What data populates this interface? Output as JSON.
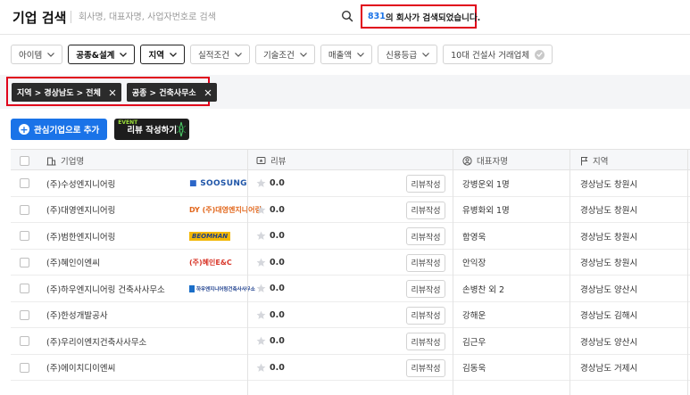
{
  "header": {
    "title": "기업 검색",
    "search_placeholder": "회사명, 대표자명, 사업자번호로 검색",
    "result_count": "831",
    "result_suffix": "의 회사가 검색되었습니다."
  },
  "filters": [
    {
      "label": "아이템",
      "active": false
    },
    {
      "label": "공종&설계",
      "active": true
    },
    {
      "label": "지역",
      "active": true
    },
    {
      "label": "실적조건",
      "active": false
    },
    {
      "label": "기술조건",
      "active": false
    },
    {
      "label": "매출액",
      "active": false
    },
    {
      "label": "신용등급",
      "active": false
    },
    {
      "label": "10대 건설사 거래업체",
      "active": false
    }
  ],
  "chips": [
    {
      "label": "지역 > 경상남도 > 전체"
    },
    {
      "label": "공종 > 건축사무소"
    }
  ],
  "actions": {
    "favorite_label": "관심기업으로 추가",
    "review_label": "리뷰 작성하기",
    "event_tag": "EVENT"
  },
  "table": {
    "headers": {
      "company": "기업명",
      "review": "리뷰",
      "ceo": "대표자명",
      "region": "지역"
    },
    "review_button_label": "리뷰작성",
    "rows": [
      {
        "company": "(주)수성엔지니어링",
        "logo": "SOOSUNG",
        "rating": "0.0",
        "ceo": "강병운외 1명",
        "region": "경상남도 창원시"
      },
      {
        "company": "(주)대영엔지니어링",
        "logo": "DY (주)대영엔지니어링",
        "rating": "0.0",
        "ceo": "유병화외 1명",
        "region": "경상남도 창원시"
      },
      {
        "company": "(주)범한엔지니어링",
        "logo": "BEOMHAN",
        "rating": "0.0",
        "ceo": "함영욱",
        "region": "경상남도 창원시"
      },
      {
        "company": "(주)혜인이엔씨",
        "logo": "(주)혜인E&C",
        "rating": "0.0",
        "ceo": "안익장",
        "region": "경상남도 창원시"
      },
      {
        "company": "(주)하우엔지니어링 건축사사무소",
        "logo": "하우엔지니어링건축사사무소",
        "rating": "0.0",
        "ceo": "손병찬 외 2",
        "region": "경상남도 양산시"
      },
      {
        "company": "(주)한성개발공사",
        "logo": "",
        "rating": "0.0",
        "ceo": "강해운",
        "region": "경상남도 김해시"
      },
      {
        "company": "(주)우리이엔지건축사사무소",
        "logo": "",
        "rating": "0.0",
        "ceo": "김근우",
        "region": "경상남도 양산시"
      },
      {
        "company": "(주)에이치디이엔씨",
        "logo": "",
        "rating": "0.0",
        "ceo": "김동욱",
        "region": "경상남도 거제시"
      }
    ]
  },
  "colors": {
    "accent": "#1a73e8",
    "highlight": "#e0001b",
    "chip_bg": "#2b2b2b"
  }
}
